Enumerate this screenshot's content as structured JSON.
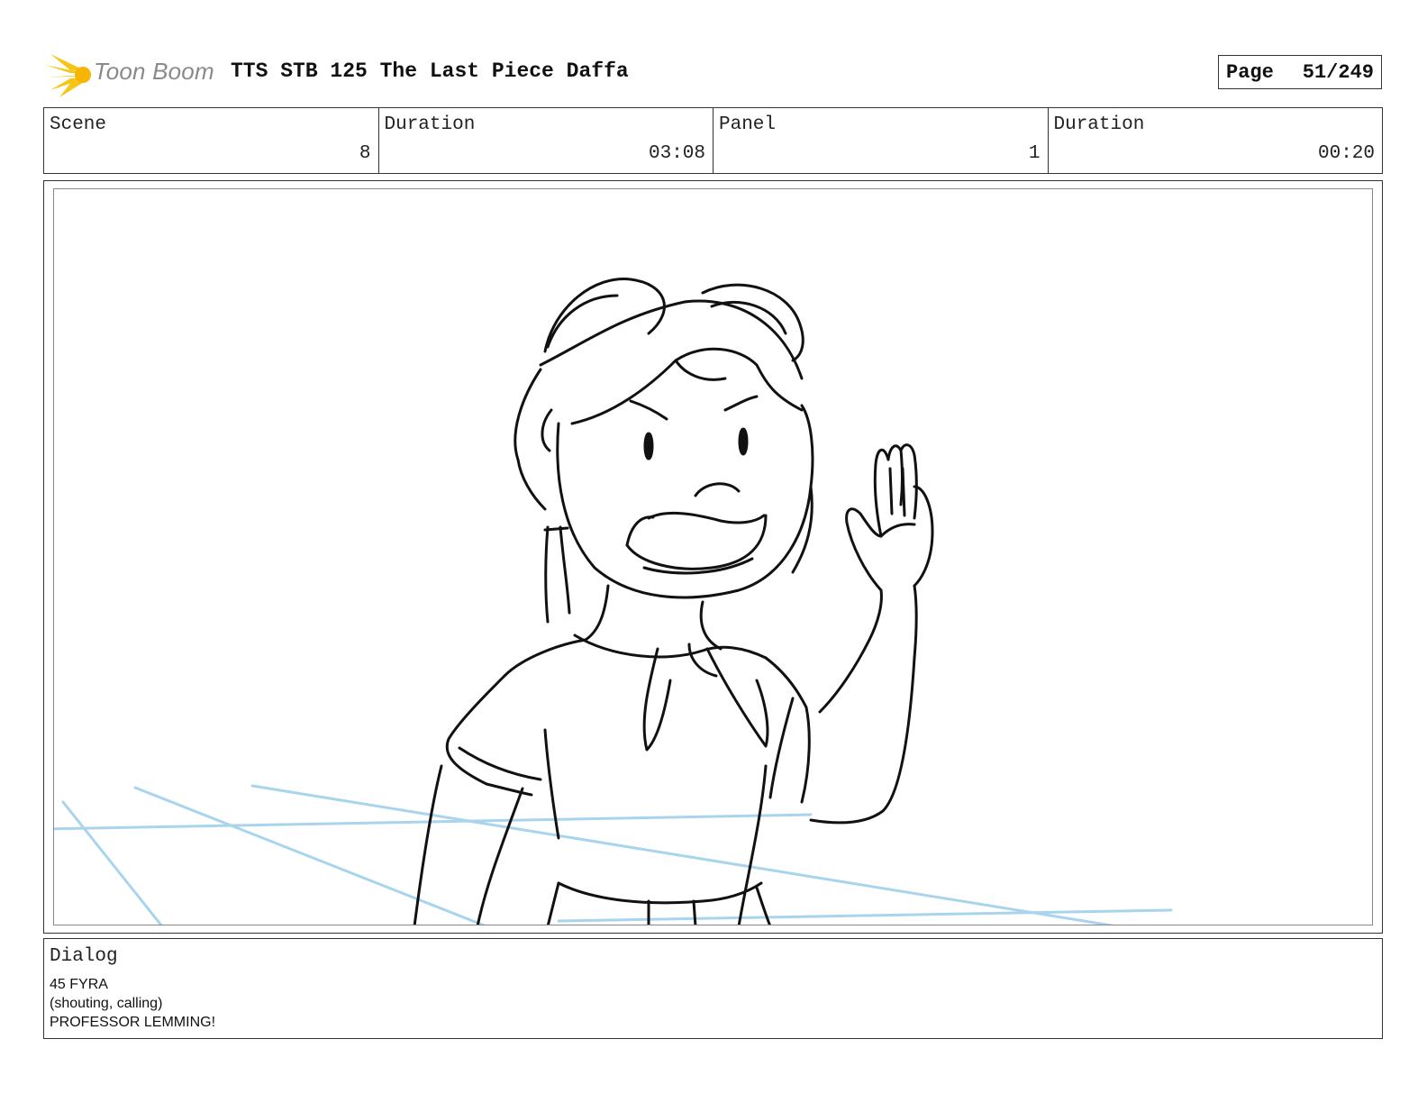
{
  "header": {
    "logo_text": "Toon Boom",
    "title": "TTS STB 125 The Last Piece Daffa",
    "page_label": "Page",
    "page_value": "51/249"
  },
  "info": {
    "scene_label": "Scene",
    "scene_value": "8",
    "scene_duration_label": "Duration",
    "scene_duration_value": "03:08",
    "panel_label": "Panel",
    "panel_value": "1",
    "panel_duration_label": "Duration",
    "panel_duration_value": "00:20"
  },
  "dialog": {
    "label": "Dialog",
    "lines": [
      "45 FYRA",
      "(shouting, calling)",
      "PROFESSOR LEMMING!"
    ]
  },
  "colors": {
    "logo_burst": "#f5c518",
    "guide_lines": "#a9d4ee",
    "sketch_ink": "#111111"
  }
}
